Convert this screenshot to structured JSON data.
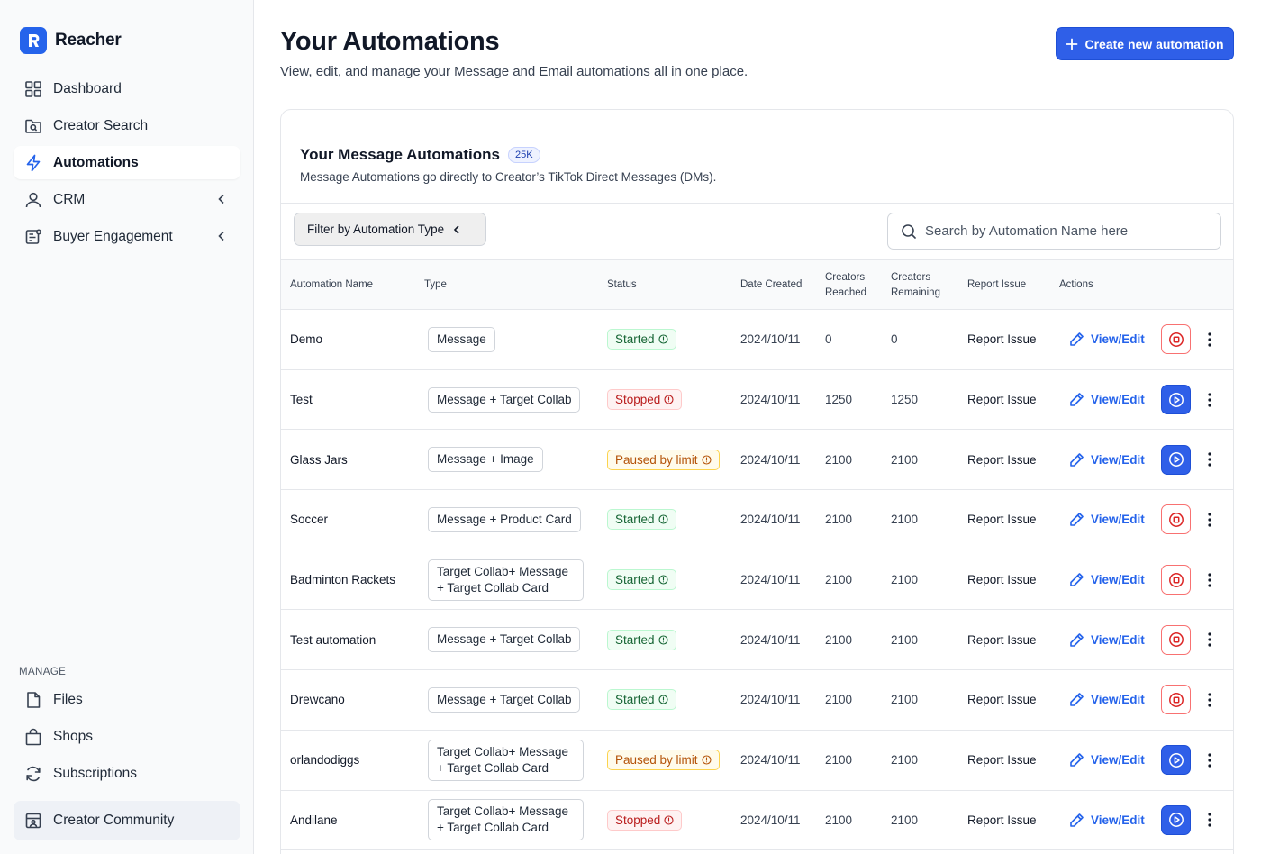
{
  "brand": {
    "name": "Reacher",
    "logo_letter": "R"
  },
  "sidebar": {
    "items": [
      {
        "label": "Dashboard",
        "icon": "grid-icon",
        "active": false,
        "chevron": false
      },
      {
        "label": "Creator Search",
        "icon": "folder-search-icon",
        "active": false,
        "chevron": false
      },
      {
        "label": "Automations",
        "icon": "lightning-icon",
        "active": true,
        "chevron": false
      },
      {
        "label": "CRM",
        "icon": "user-icon",
        "active": false,
        "chevron": true
      },
      {
        "label": "Buyer Engagement",
        "icon": "engagement-icon",
        "active": false,
        "chevron": true
      }
    ],
    "manage_label": "MANAGE",
    "manage_items": [
      {
        "label": "Files",
        "icon": "file-icon"
      },
      {
        "label": "Shops",
        "icon": "shopping-bag-icon"
      },
      {
        "label": "Subscriptions",
        "icon": "refresh-icon"
      }
    ],
    "community": {
      "label": "Creator Community",
      "icon": "community-icon"
    }
  },
  "header": {
    "title": "Your Automations",
    "subtitle": "View, edit, and manage your Message and Email automations all in one place.",
    "create_label": "Create new automation"
  },
  "card": {
    "title": "Your Message Automations",
    "badge": "25K",
    "description": "Message Automations go directly to Creator’s TikTok Direct Messages (DMs).",
    "filter_label": "Filter by Automation Type",
    "search_placeholder": "Search by Automation Name here"
  },
  "table": {
    "columns": {
      "name": "Automation Name",
      "type": "Type",
      "status": "Status",
      "date": "Date Created",
      "reached_1": "Creators",
      "reached_2": "Reached",
      "remaining_1": "Creators",
      "remaining_2": "Remaining",
      "report": "Report Issue",
      "actions": "Actions"
    },
    "report_label": "Report Issue",
    "view_label": "View/Edit",
    "rows": [
      {
        "name": "Demo",
        "type": "Message",
        "status": "Started",
        "status_kind": "green",
        "date": "2024/10/11",
        "reached": "0",
        "remaining": "0",
        "action": "stop"
      },
      {
        "name": "Test",
        "type": "Message + Target Collab",
        "status": "Stopped",
        "status_kind": "red",
        "date": "2024/10/11",
        "reached": "1250",
        "remaining": "1250",
        "action": "play"
      },
      {
        "name": "Glass Jars",
        "type": "Message + Image",
        "status": "Paused by limit",
        "status_kind": "yellow",
        "date": "2024/10/11",
        "reached": "2100",
        "remaining": "2100",
        "action": "play"
      },
      {
        "name": "Soccer",
        "type": "Message + Product Card",
        "status": "Started",
        "status_kind": "green",
        "date": "2024/10/11",
        "reached": "2100",
        "remaining": "2100",
        "action": "stop"
      },
      {
        "name": "Badminton Rackets",
        "type": "Target Collab+ Message + Target Collab Card",
        "status": "Started",
        "status_kind": "green",
        "date": "2024/10/11",
        "reached": "2100",
        "remaining": "2100",
        "action": "stop"
      },
      {
        "name": "Test automation",
        "type": "Message + Target Collab",
        "status": "Started",
        "status_kind": "green",
        "date": "2024/10/11",
        "reached": "2100",
        "remaining": "2100",
        "action": "stop"
      },
      {
        "name": "Drewcano",
        "type": "Message + Target Collab",
        "status": "Started",
        "status_kind": "green",
        "date": "2024/10/11",
        "reached": "2100",
        "remaining": "2100",
        "action": "stop"
      },
      {
        "name": "orlandodiggs",
        "type": "Target Collab+ Message + Target Collab Card",
        "status": "Paused by limit",
        "status_kind": "yellow",
        "date": "2024/10/11",
        "reached": "2100",
        "remaining": "2100",
        "action": "play"
      },
      {
        "name": "Andilane",
        "type": "Target Collab+ Message + Target Collab Card",
        "status": "Stopped",
        "status_kind": "red",
        "date": "2024/10/11",
        "reached": "2100",
        "remaining": "2100",
        "action": "play"
      }
    ]
  },
  "colors": {
    "accent": "#2f5fe8",
    "started": "#166534",
    "stopped": "#b91c1c",
    "paused": "#b45309"
  }
}
